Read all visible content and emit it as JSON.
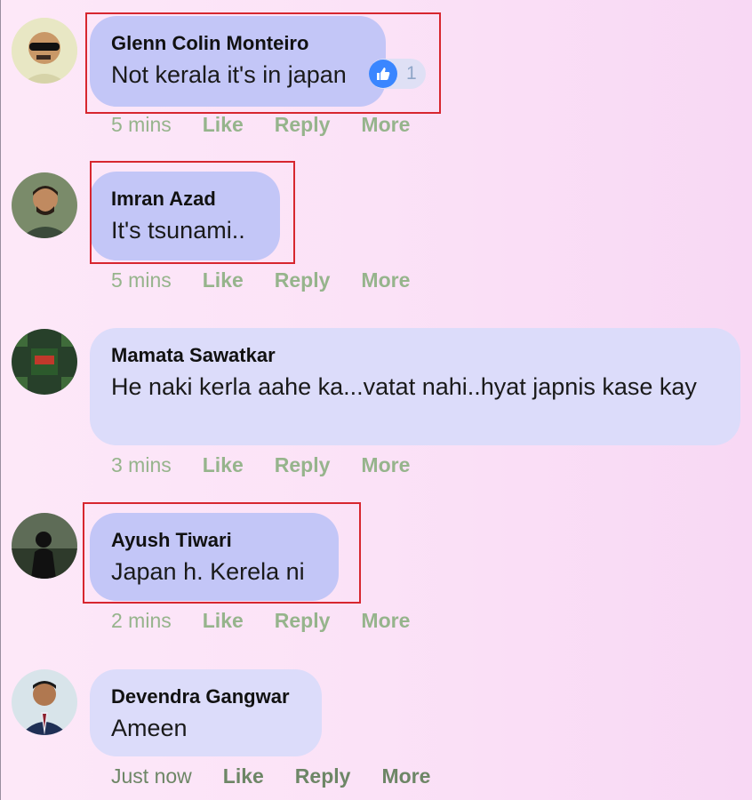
{
  "comments": [
    {
      "author": "Glenn Colin Monteiro",
      "text": "Not kerala it's in japan",
      "time": "5 mins",
      "like": "Like",
      "reply": "Reply",
      "more": "More",
      "reactions": "1"
    },
    {
      "author": "Imran Azad",
      "text": "It's tsunami..",
      "time": "5 mins",
      "like": "Like",
      "reply": "Reply",
      "more": "More"
    },
    {
      "author": "Mamata Sawatkar",
      "text": "He naki kerla aahe ka...vatat nahi..hyat japnis kase kay",
      "time": "3 mins",
      "like": "Like",
      "reply": "Reply",
      "more": "More"
    },
    {
      "author": "Ayush Tiwari",
      "text": "Japan h. Kerela ni",
      "time": "2 mins",
      "like": "Like",
      "reply": "Reply",
      "more": "More"
    },
    {
      "author": "Devendra Gangwar",
      "text": "Ameen",
      "time": "Just now",
      "like": "Like",
      "reply": "Reply",
      "more": "More"
    }
  ],
  "colors": {
    "highlight_box": "#d7262f",
    "like_badge": "#3a86ff",
    "action_text": "#96b48c"
  }
}
